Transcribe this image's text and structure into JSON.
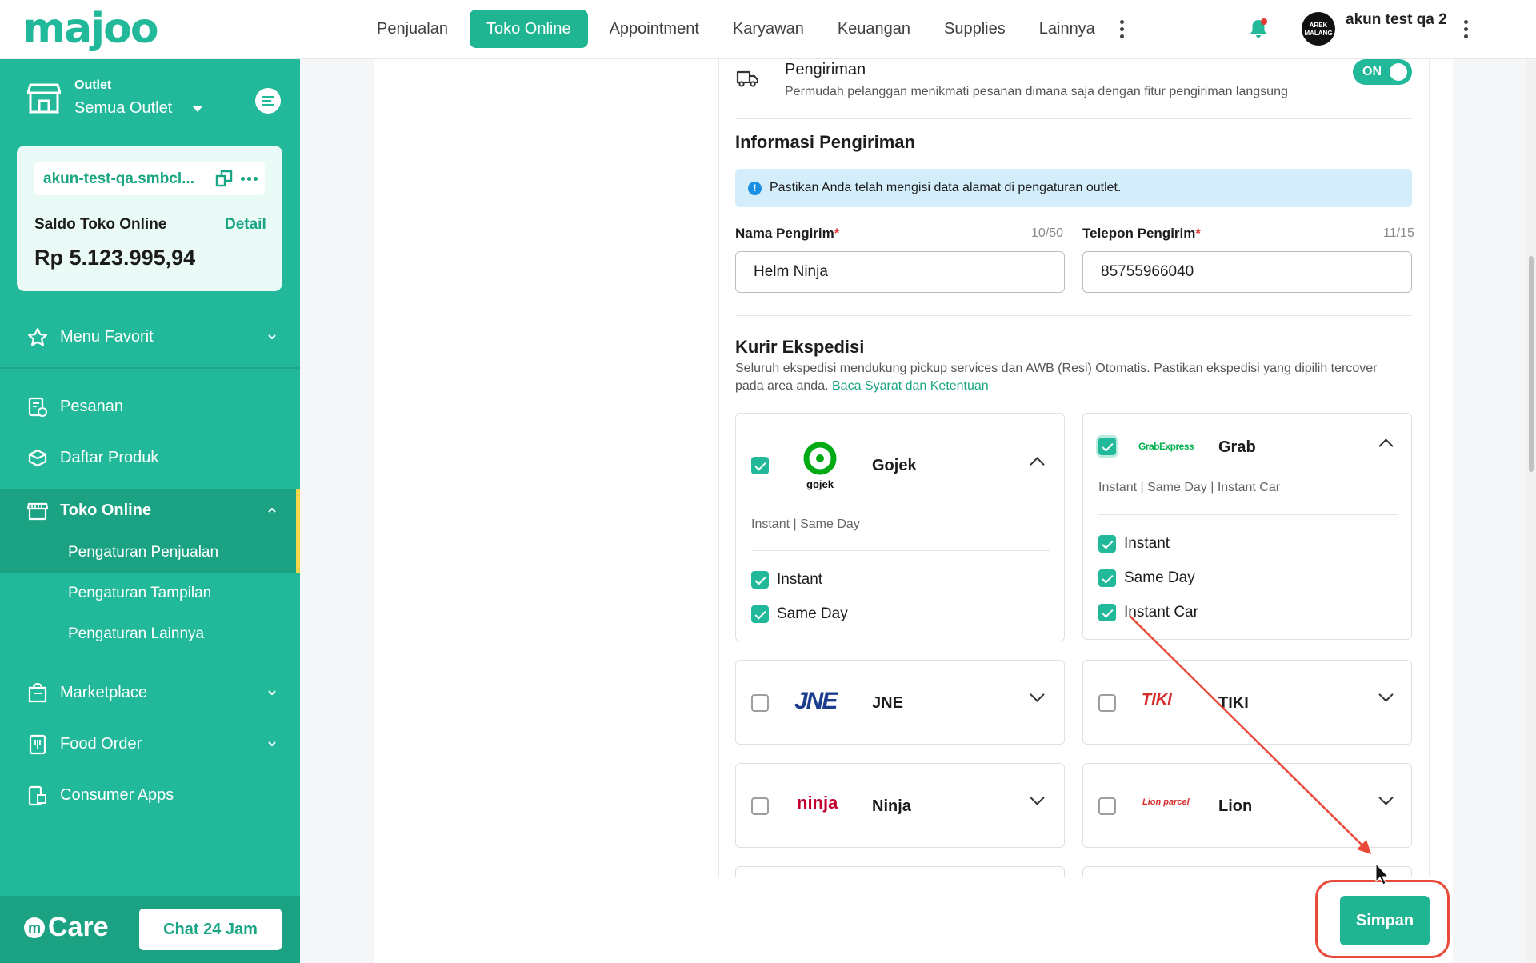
{
  "topbar": {
    "logo": "majoo",
    "nav": [
      "Penjualan",
      "Toko Online",
      "Appointment",
      "Karyawan",
      "Keuangan",
      "Supplies",
      "Lainnya"
    ],
    "active_nav": "Toko Online",
    "avatar_text": "AREK MALANG",
    "user_name": "akun test qa 2"
  },
  "sidebar": {
    "outlet_label": "Outlet",
    "outlet_value": "Semua Outlet",
    "store_link": "akun-test-qa.smbcl...",
    "saldo_label": "Saldo Toko Online",
    "saldo_detail": "Detail",
    "saldo_value": "Rp 5.123.995,94",
    "menu": {
      "favorit": "Menu Favorit",
      "pesanan": "Pesanan",
      "produk": "Daftar Produk",
      "toko_online": "Toko Online",
      "marketplace": "Marketplace",
      "food_order": "Food Order",
      "consumer_apps": "Consumer Apps"
    },
    "submenu": [
      "Pengaturan Penjualan",
      "Pengaturan Tampilan",
      "Pengaturan Lainnya"
    ],
    "care_label": "Care",
    "chat_label": "Chat 24 Jam"
  },
  "pengiriman": {
    "title": "Pengiriman",
    "desc": "Permudah pelanggan menikmati pesanan dimana saja dengan fitur pengiriman langsung",
    "toggle": "ON"
  },
  "info": {
    "title": "Informasi Pengiriman",
    "alert": "Pastikan Anda telah mengisi data alamat di pengaturan outlet.",
    "nama_label": "Nama Pengirim",
    "nama_count": "10/50",
    "nama_value": "Helm Ninja",
    "telp_label": "Telepon Pengirim",
    "telp_count": "11/15",
    "telp_value": "85755966040"
  },
  "kurir": {
    "title": "Kurir Ekspedisi",
    "desc": "Seluruh ekspedisi mendukung pickup services dan AWB (Resi) Otomatis. Pastikan ekspedisi yang dipilih tercover pada area anda.",
    "link": "Baca Syarat dan Ketentuan",
    "gojek": {
      "name": "Gojek",
      "logo": "gojek",
      "services": "Instant | Same Day",
      "options": [
        "Instant",
        "Same Day"
      ]
    },
    "grab": {
      "name": "Grab",
      "logo": "GrabExpress",
      "services": "Instant | Same Day | Instant Car",
      "options": [
        "Instant",
        "Same Day",
        "Instant Car"
      ]
    },
    "jne": {
      "name": "JNE",
      "logo": "JNE"
    },
    "tiki": {
      "name": "TIKI",
      "logo": "TIKI"
    },
    "ninja": {
      "name": "Ninja",
      "logo": "ninja"
    },
    "lion": {
      "name": "Lion",
      "logo": "Lion parcel"
    }
  },
  "save_label": "Simpan",
  "colors": {
    "brand": "#22b99a",
    "accent_red": "#e84a3a",
    "info_bg": "#d3edfb"
  }
}
